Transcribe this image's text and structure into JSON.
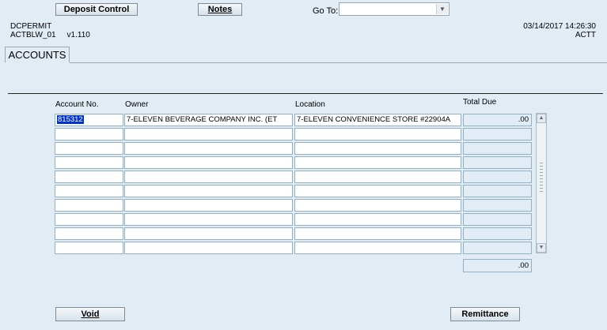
{
  "toolbar": {
    "deposit_control": "Deposit Control",
    "notes": "Notes",
    "goto_label": "Go To:",
    "goto_value": ""
  },
  "header": {
    "form_name": "DCPERMIT",
    "form_id": "ACTBLW_01",
    "version": "v1.110",
    "datetime": "03/14/2017 14:26:30",
    "user": "ACTT"
  },
  "tab": {
    "label": "ACCOUNTS"
  },
  "table": {
    "columns": [
      "Account No.",
      "Owner",
      "Location",
      "Total Due"
    ],
    "rows": [
      {
        "account": "815312",
        "owner": "7-ELEVEN BEVERAGE COMPANY INC. (ET",
        "location": "7-ELEVEN CONVENIENCE STORE #22904A",
        "due": ".00"
      },
      {
        "account": "",
        "owner": "",
        "location": "",
        "due": ""
      },
      {
        "account": "",
        "owner": "",
        "location": "",
        "due": ""
      },
      {
        "account": "",
        "owner": "",
        "location": "",
        "due": ""
      },
      {
        "account": "",
        "owner": "",
        "location": "",
        "due": ""
      },
      {
        "account": "",
        "owner": "",
        "location": "",
        "due": ""
      },
      {
        "account": "",
        "owner": "",
        "location": "",
        "due": ""
      },
      {
        "account": "",
        "owner": "",
        "location": "",
        "due": ""
      },
      {
        "account": "",
        "owner": "",
        "location": "",
        "due": ""
      },
      {
        "account": "",
        "owner": "",
        "location": "",
        "due": ""
      }
    ],
    "total": ".00"
  },
  "buttons": {
    "void": "Void",
    "remittance": "Remittance"
  }
}
